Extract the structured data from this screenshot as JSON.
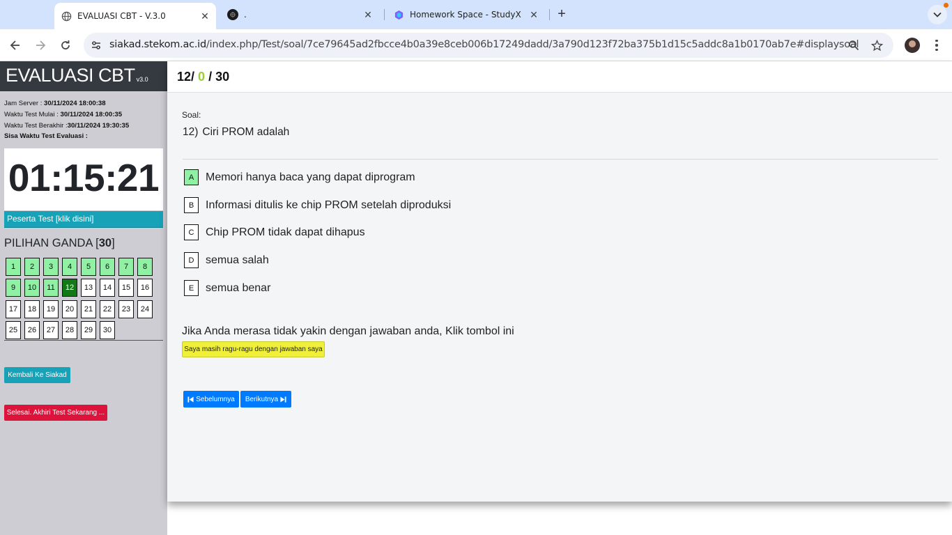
{
  "browser": {
    "tabs": [
      {
        "title": "EVALUASI CBT - V.3.0",
        "favicon": "globe-icon",
        "active": true
      },
      {
        "title": ".",
        "favicon": "dark-circle-icon",
        "active": false
      },
      {
        "title": "Homework Space - StudyX",
        "favicon": "studyx-icon",
        "active": false
      }
    ],
    "url_host": "siakad.stekom.ac.id",
    "url_path": "/index.php/Test/soal/7ce79645ad2fbcce4b0a39e8ceb006b17249dadd/3a790d123f72ba375b1d15c5addc8a1b0170ab7e#displaysoal"
  },
  "sidebar": {
    "brand": "EVALUASI CBT",
    "version": "v3.0",
    "jam_server_label": "Jam Server : ",
    "jam_server_value": "30/11/2024 18:00:38",
    "waktu_mulai_label": "Waktu Test Mulai : ",
    "waktu_mulai_value": "30/11/2024 18:00:35",
    "waktu_berakhir_label": "Waktu Test Berakhir :",
    "waktu_berakhir_value": "30/11/2024 19:30:35",
    "sisa_waktu_label": "Sisa Waktu Test Evaluasi :",
    "timer": "01:15:21",
    "peserta_label": "Peserta Test [klik disini]",
    "pilihan_ganda_label": "PILIHAN GANDA [",
    "pilihan_ganda_count": "30",
    "pilihan_ganda_close": "]",
    "questions": [
      {
        "n": "1",
        "state": "answered"
      },
      {
        "n": "2",
        "state": "answered"
      },
      {
        "n": "3",
        "state": "answered"
      },
      {
        "n": "4",
        "state": "answered"
      },
      {
        "n": "5",
        "state": "answered"
      },
      {
        "n": "6",
        "state": "answered"
      },
      {
        "n": "7",
        "state": "answered"
      },
      {
        "n": "8",
        "state": "answered"
      },
      {
        "n": "9",
        "state": "answered"
      },
      {
        "n": "10",
        "state": "answered"
      },
      {
        "n": "11",
        "state": "answered"
      },
      {
        "n": "12",
        "state": "current"
      },
      {
        "n": "13",
        "state": "empty"
      },
      {
        "n": "14",
        "state": "empty"
      },
      {
        "n": "15",
        "state": "empty"
      },
      {
        "n": "16",
        "state": "empty"
      },
      {
        "n": "17",
        "state": "empty"
      },
      {
        "n": "18",
        "state": "empty"
      },
      {
        "n": "19",
        "state": "empty"
      },
      {
        "n": "20",
        "state": "empty"
      },
      {
        "n": "21",
        "state": "empty"
      },
      {
        "n": "22",
        "state": "empty"
      },
      {
        "n": "23",
        "state": "empty"
      },
      {
        "n": "24",
        "state": "empty"
      },
      {
        "n": "25",
        "state": "empty"
      },
      {
        "n": "26",
        "state": "empty"
      },
      {
        "n": "27",
        "state": "empty"
      },
      {
        "n": "28",
        "state": "empty"
      },
      {
        "n": "29",
        "state": "empty"
      },
      {
        "n": "30",
        "state": "empty"
      }
    ],
    "btn_kembali": "Kembali Ke Siakad",
    "btn_selesai": "Selesai. Akhiri Test Sekarang ..."
  },
  "main": {
    "counter_current": "12/",
    "counter_answered": "0",
    "counter_total": "/ 30",
    "soal_label": "Soal:",
    "question_number": "12)",
    "question_text": "Ciri PROM adalah",
    "options": [
      {
        "letter": "A",
        "text": "Memori hanya baca yang dapat diprogram",
        "selected": true
      },
      {
        "letter": "B",
        "text": "Informasi ditulis ke chip PROM setelah diproduksi",
        "selected": false
      },
      {
        "letter": "C",
        "text": "Chip PROM tidak dapat dihapus",
        "selected": false
      },
      {
        "letter": "D",
        "text": "semua salah",
        "selected": false
      },
      {
        "letter": "E",
        "text": "semua benar",
        "selected": false
      }
    ],
    "ragu_text": "Jika Anda merasa tidak yakin dengan jawaban anda, Klik tombol ini",
    "ragu_button": "Saya masih ragu-ragu dengan jawaban saya",
    "prev_button": "Sebelumnya",
    "next_button": "Berikutnya"
  },
  "colors": {
    "answered": "#90f1a4",
    "current": "#117a16",
    "teal": "#17a2b8",
    "danger": "#dc143c",
    "primary": "#007bff",
    "warning": "#f0f03a"
  }
}
